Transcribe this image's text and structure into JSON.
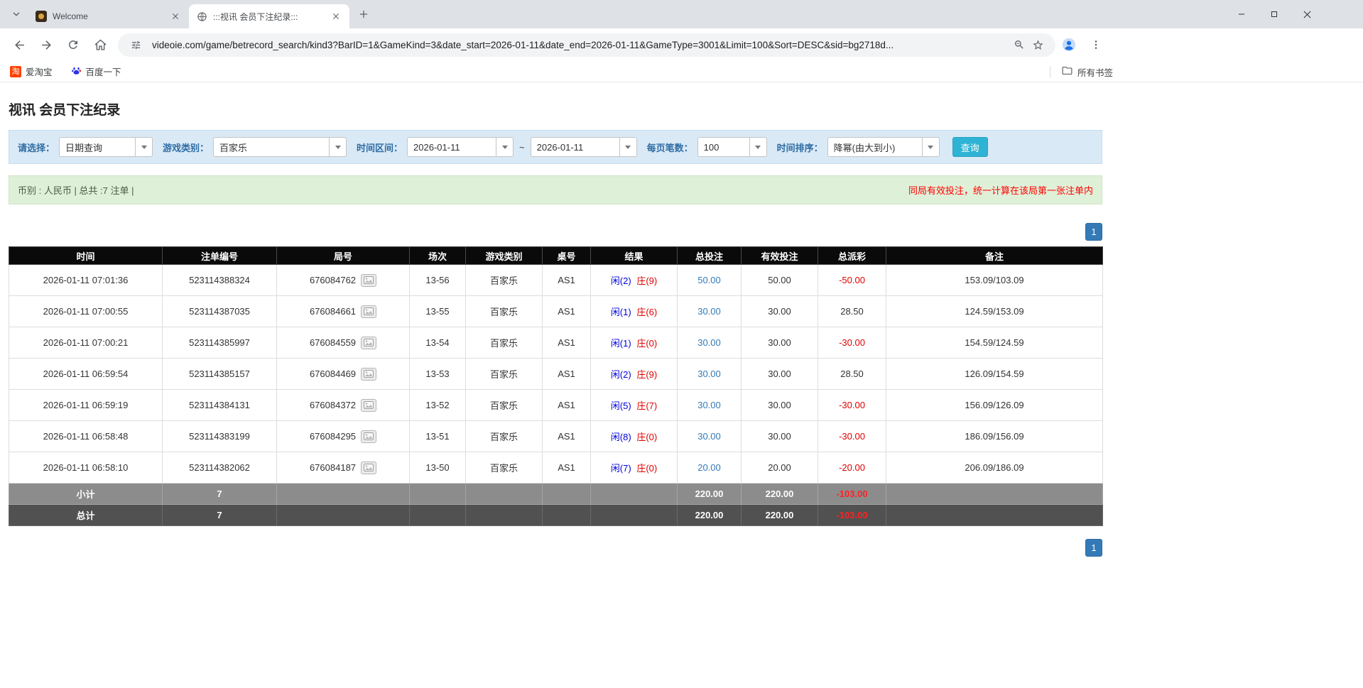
{
  "browser": {
    "tabs": [
      {
        "title": "Welcome"
      },
      {
        "title": ":::视讯 会员下注纪录:::"
      }
    ],
    "url": "videoie.com/game/betrecord_search/kind3?BarID=1&GameKind=3&date_start=2026-01-11&date_end=2026-01-11&GameType=3001&Limit=100&Sort=DESC&sid=bg2718d...",
    "bookmarks": [
      {
        "label": "爱淘宝",
        "icon_glyph": "淘"
      },
      {
        "label": "百度一下"
      }
    ],
    "all_bookmarks_label": "所有书签"
  },
  "page": {
    "title": "视讯 会员下注纪录",
    "filters": {
      "select_label": "请选择：",
      "select_value": "日期查询",
      "game_label": "游戏类别：",
      "game_value": "百家乐",
      "range_label": "时间区间：",
      "date_start": "2026-01-11",
      "range_separator": "~",
      "date_end": "2026-01-11",
      "per_page_label": "每页笔数：",
      "per_page_value": "100",
      "sort_label": "时间排序：",
      "sort_value": "降幂(由大到小)",
      "search_button_label": "查询"
    },
    "info_bar": {
      "summary": "币别 : 人民币 | 总共 :7 注单 |",
      "notice": "同局有效投注，统一计算在该局第一张注单内"
    },
    "pagination": {
      "current_page": "1"
    },
    "table": {
      "headers": [
        "时间",
        "注单编号",
        "局号",
        "场次",
        "游戏类别",
        "桌号",
        "结果",
        "总投注",
        "有效投注",
        "总派彩",
        "备注"
      ],
      "rows": [
        {
          "time": "2026-01-11 07:01:36",
          "bet_id": "523114388324",
          "round_id": "676084762",
          "session": "13-56",
          "game_type": "百家乐",
          "table_no": "AS1",
          "result_player": "闲(2)",
          "result_banker": "庄(9)",
          "total_bet": "50.00",
          "valid_bet": "50.00",
          "payout": "-50.00",
          "note": "153.09/103.09"
        },
        {
          "time": "2026-01-11 07:00:55",
          "bet_id": "523114387035",
          "round_id": "676084661",
          "session": "13-55",
          "game_type": "百家乐",
          "table_no": "AS1",
          "result_player": "闲(1)",
          "result_banker": "庄(6)",
          "total_bet": "30.00",
          "valid_bet": "30.00",
          "payout": "28.50",
          "note": "124.59/153.09"
        },
        {
          "time": "2026-01-11 07:00:21",
          "bet_id": "523114385997",
          "round_id": "676084559",
          "session": "13-54",
          "game_type": "百家乐",
          "table_no": "AS1",
          "result_player": "闲(1)",
          "result_banker": "庄(0)",
          "total_bet": "30.00",
          "valid_bet": "30.00",
          "payout": "-30.00",
          "note": "154.59/124.59"
        },
        {
          "time": "2026-01-11 06:59:54",
          "bet_id": "523114385157",
          "round_id": "676084469",
          "session": "13-53",
          "game_type": "百家乐",
          "table_no": "AS1",
          "result_player": "闲(2)",
          "result_banker": "庄(9)",
          "total_bet": "30.00",
          "valid_bet": "30.00",
          "payout": "28.50",
          "note": "126.09/154.59"
        },
        {
          "time": "2026-01-11 06:59:19",
          "bet_id": "523114384131",
          "round_id": "676084372",
          "session": "13-52",
          "game_type": "百家乐",
          "table_no": "AS1",
          "result_player": "闲(5)",
          "result_banker": "庄(7)",
          "total_bet": "30.00",
          "valid_bet": "30.00",
          "payout": "-30.00",
          "note": "156.09/126.09"
        },
        {
          "time": "2026-01-11 06:58:48",
          "bet_id": "523114383199",
          "round_id": "676084295",
          "session": "13-51",
          "game_type": "百家乐",
          "table_no": "AS1",
          "result_player": "闲(8)",
          "result_banker": "庄(0)",
          "total_bet": "30.00",
          "valid_bet": "30.00",
          "payout": "-30.00",
          "note": "186.09/156.09"
        },
        {
          "time": "2026-01-11 06:58:10",
          "bet_id": "523114382062",
          "round_id": "676084187",
          "session": "13-50",
          "game_type": "百家乐",
          "table_no": "AS1",
          "result_player": "闲(7)",
          "result_banker": "庄(0)",
          "total_bet": "20.00",
          "valid_bet": "20.00",
          "payout": "-20.00",
          "note": "206.09/186.09"
        }
      ],
      "subtotal": {
        "label": "小计",
        "count": "7",
        "total_bet": "220.00",
        "valid_bet": "220.00",
        "payout": "-103.00"
      },
      "grand_total": {
        "label": "总计",
        "count": "7",
        "total_bet": "220.00",
        "valid_bet": "220.00",
        "payout": "-103.00"
      }
    }
  },
  "colors": {
    "accent_blue": "#337ab7",
    "player_blue": "#0000dd",
    "banker_red": "#e00000",
    "negative_red": "#e00000",
    "search_button": "#2eb3d4",
    "filter_bg": "#d9e9f6",
    "info_bg": "#dff0d8",
    "table_header_bg": "#0a0a0a"
  }
}
